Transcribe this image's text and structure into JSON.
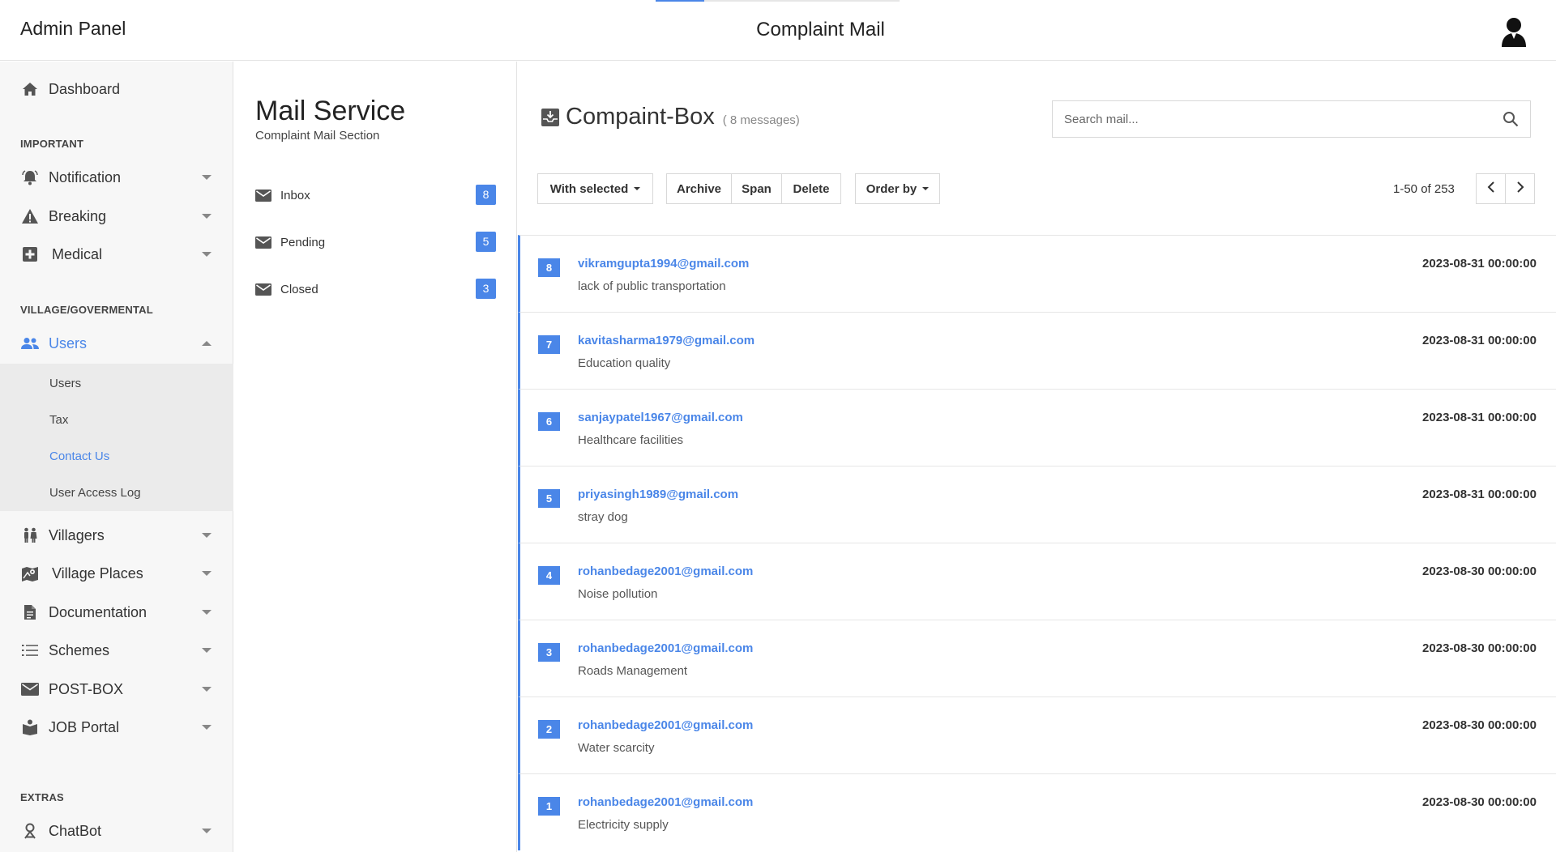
{
  "topbar": {
    "brand": "Admin Panel",
    "title": "Complaint Mail",
    "progress_fraction": 0.2
  },
  "sidebar": {
    "dashboard": "Dashboard",
    "section_important": "IMPORTANT",
    "notification": "Notification",
    "breaking": "Breaking",
    "medical": "Medical",
    "section_village": "VILLAGE/GOVERMENTAL",
    "users": "Users",
    "submenu": [
      "Users",
      "Tax",
      "Contact Us",
      "User Access Log"
    ],
    "villagers": "Villagers",
    "village_places": "Village Places",
    "documentation": "Documentation",
    "schemes": "Schemes",
    "postbox": "POST-BOX",
    "job_portal": "JOB Portal",
    "section_extras": "EXTRAS",
    "chatbot": "ChatBot"
  },
  "mail_service": {
    "title": "Mail Service",
    "subtitle": "Complaint Mail Section",
    "folders": [
      {
        "label": "Inbox",
        "count": "8"
      },
      {
        "label": "Pending",
        "count": "5"
      },
      {
        "label": "Closed",
        "count": "3"
      }
    ]
  },
  "main": {
    "box_title": "Compaint-Box",
    "message_count": "( 8 messages)",
    "search_placeholder": "Search mail...",
    "with_selected": "With selected",
    "archive": "Archive",
    "span": "Span",
    "delete": "Delete",
    "order_by": "Order by",
    "pager": "1-50 of 253"
  },
  "mails": [
    {
      "num": "8",
      "from": "vikramgupta1994@gmail.com",
      "subject": "lack of public transportation",
      "date": "2023-08-31 00:00:00"
    },
    {
      "num": "7",
      "from": "kavitasharma1979@gmail.com",
      "subject": "Education quality",
      "date": "2023-08-31 00:00:00"
    },
    {
      "num": "6",
      "from": "sanjaypatel1967@gmail.com",
      "subject": "Healthcare facilities",
      "date": "2023-08-31 00:00:00"
    },
    {
      "num": "5",
      "from": "priyasingh1989@gmail.com",
      "subject": "stray dog",
      "date": "2023-08-31 00:00:00"
    },
    {
      "num": "4",
      "from": "rohanbedage2001@gmail.com",
      "subject": "Noise pollution",
      "date": "2023-08-30 00:00:00"
    },
    {
      "num": "3",
      "from": "rohanbedage2001@gmail.com",
      "subject": "Roads Management",
      "date": "2023-08-30 00:00:00"
    },
    {
      "num": "2",
      "from": "rohanbedage2001@gmail.com",
      "subject": "Water scarcity",
      "date": "2023-08-30 00:00:00"
    },
    {
      "num": "1",
      "from": "rohanbedage2001@gmail.com",
      "subject": "Electricity supply",
      "date": "2023-08-30 00:00:00"
    }
  ],
  "colors": {
    "accent": "#4a86e8",
    "sidebar_bg": "#f7f7f7",
    "submenu_bg": "#ebebeb"
  },
  "icons": [
    "home-icon",
    "bell-icon",
    "warning-icon",
    "medical-plus-icon",
    "users-icon",
    "villagers-icon",
    "map-icon",
    "document-icon",
    "list-icon",
    "envelope-icon",
    "book-icon",
    "chatbot-icon",
    "download-box-icon",
    "search-icon",
    "chevron-left-icon",
    "chevron-right-icon",
    "user-avatar-icon"
  ]
}
